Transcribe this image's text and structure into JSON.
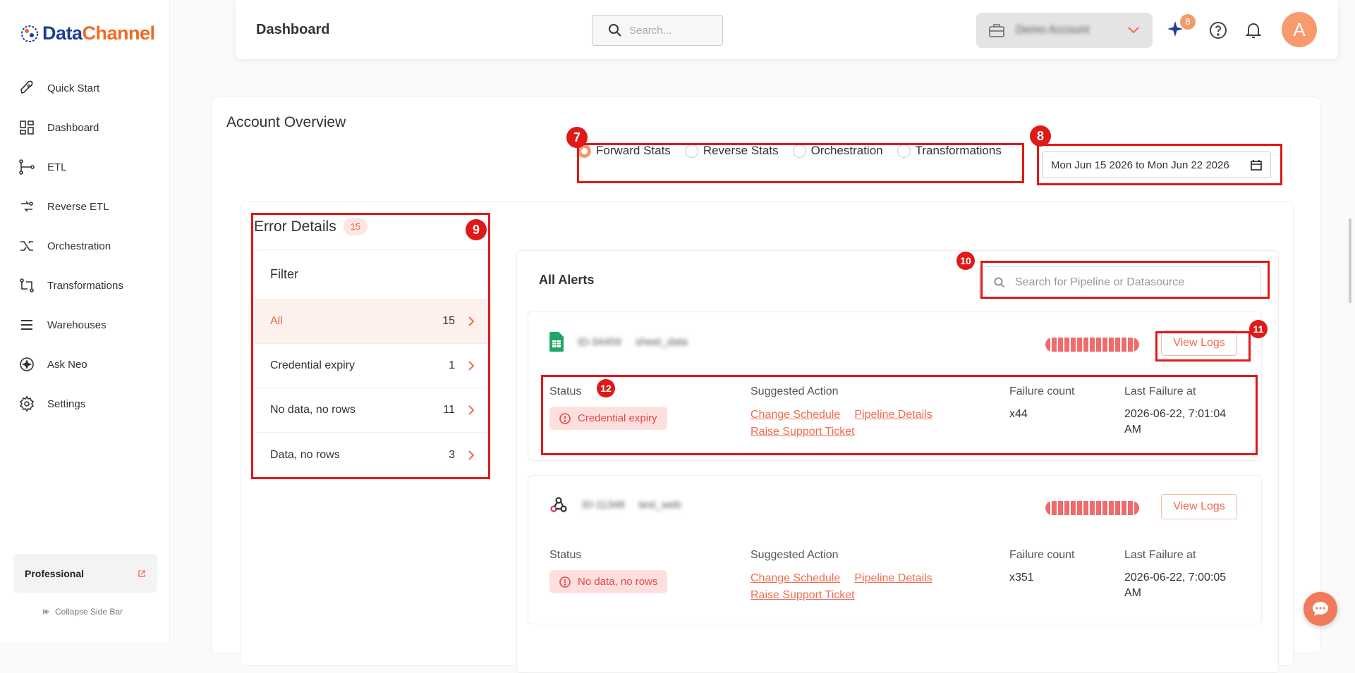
{
  "brand": {
    "part1": "Data",
    "part2": "Channel"
  },
  "sidebar": {
    "items": [
      {
        "label": "Quick Start",
        "icon": "rocket-icon"
      },
      {
        "label": "Dashboard",
        "icon": "dashboard-icon"
      },
      {
        "label": "ETL",
        "icon": "etl-icon"
      },
      {
        "label": "Reverse ETL",
        "icon": "reverse-etl-icon"
      },
      {
        "label": "Orchestration",
        "icon": "orchestration-icon"
      },
      {
        "label": "Transformations",
        "icon": "transformations-icon"
      },
      {
        "label": "Warehouses",
        "icon": "warehouses-icon"
      },
      {
        "label": "Ask Neo",
        "icon": "ask-neo-icon"
      },
      {
        "label": "Settings",
        "icon": "gear-icon"
      }
    ],
    "plan": "Professional",
    "collapse": "Collapse Side Bar"
  },
  "header": {
    "title": "Dashboard",
    "search_placeholder": "Search...",
    "workspace": "Demo Account",
    "notif_count": "8",
    "avatar_letter": "A"
  },
  "overview": {
    "title": "Account Overview",
    "stat_options": [
      "Forward Stats",
      "Reverse Stats",
      "Orchestration",
      "Transformations"
    ],
    "selected_stat": "Forward Stats",
    "date_range": "Mon Jun 15 2026 to Mon Jun 22 2026"
  },
  "errors": {
    "title": "Error Details",
    "count": "15",
    "filter_title": "Filter",
    "filters": [
      {
        "label": "All",
        "count": "15"
      },
      {
        "label": "Credential expiry",
        "count": "1"
      },
      {
        "label": "No data, no rows",
        "count": "11"
      },
      {
        "label": "Data, no rows",
        "count": "3"
      }
    ]
  },
  "alerts": {
    "title": "All Alerts",
    "search_placeholder": "Search for Pipeline or Datasource",
    "view_logs": "View Logs",
    "col_status": "Status",
    "col_action": "Suggested Action",
    "col_failure": "Failure count",
    "col_last": "Last Failure at",
    "action_change": "Change Schedule",
    "action_details": "Pipeline Details",
    "action_ticket": "Raise Support Ticket",
    "cards": [
      {
        "id": "ID-34459",
        "name": "sheet_data",
        "status": "Credential expiry",
        "failures": "x44",
        "last_date": "2026-06-22, 7:01:04",
        "last_ampm": "AM"
      },
      {
        "id": "ID-11348",
        "name": "test_web",
        "status": "No data, no rows",
        "failures": "x351",
        "last_date": "2026-06-22, 7:00:05",
        "last_ampm": "AM"
      }
    ]
  },
  "annotations": [
    "7",
    "8",
    "9",
    "10",
    "11",
    "12"
  ]
}
